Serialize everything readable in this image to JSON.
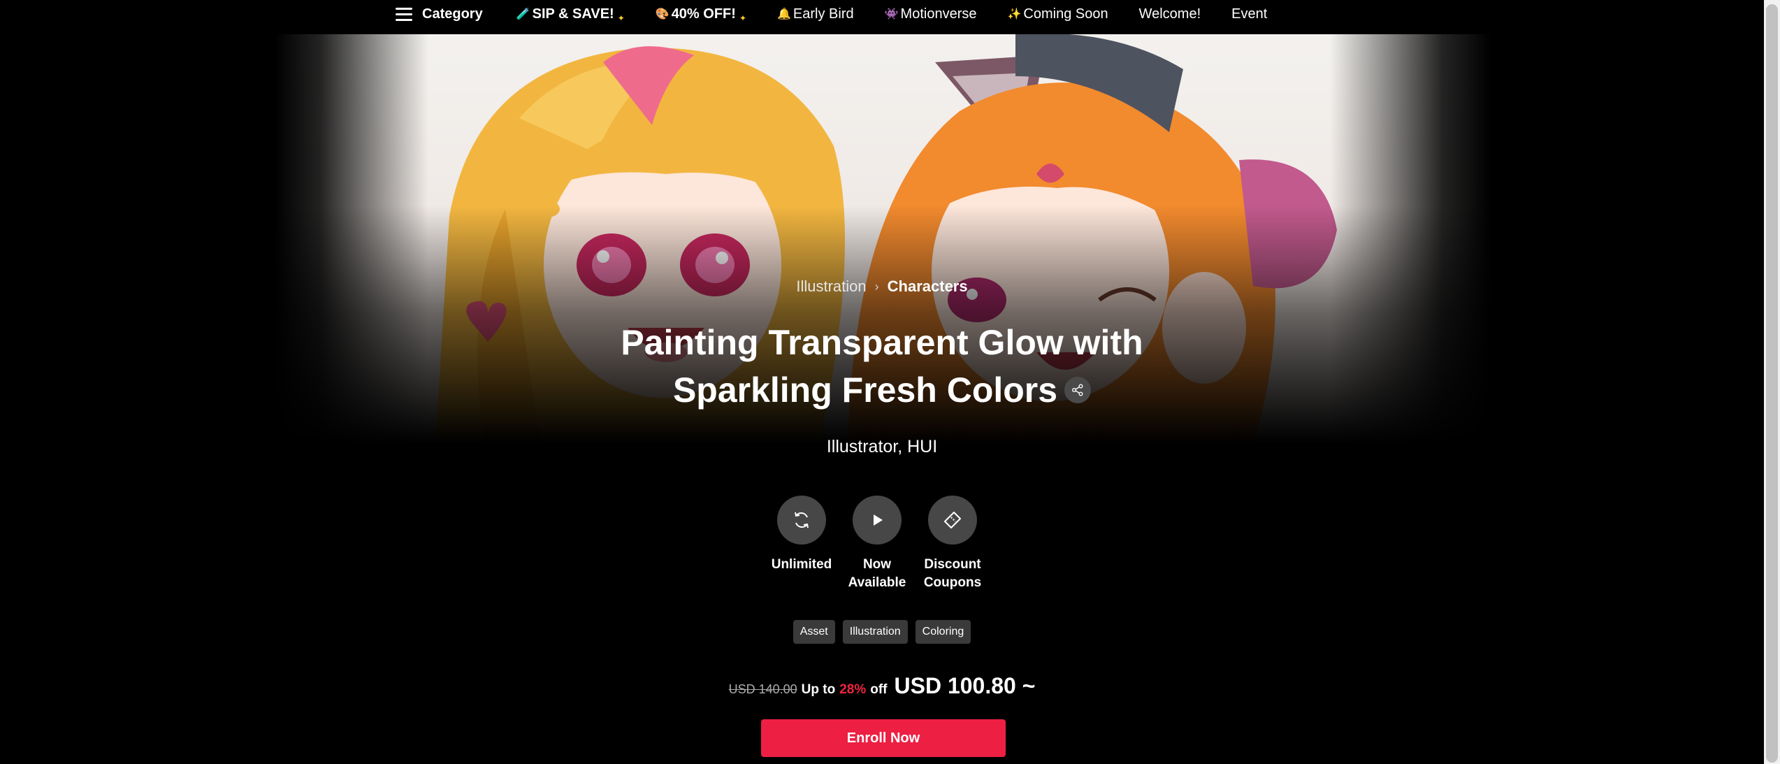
{
  "nav": {
    "category_label": "Category",
    "items": [
      {
        "emoji": "🧪",
        "label": "SIP & SAVE!",
        "spark": "✦",
        "bold": true
      },
      {
        "emoji": "🎨",
        "label": "40% OFF!",
        "spark": "✦",
        "bold": true
      },
      {
        "emoji": "🔔",
        "label": "Early Bird",
        "spark": "",
        "bold": false
      },
      {
        "emoji": "👾",
        "label": "Motionverse",
        "spark": "",
        "bold": false
      },
      {
        "emoji": "✨",
        "label": "Coming Soon",
        "spark": "",
        "bold": false
      },
      {
        "emoji": "",
        "label": "Welcome!",
        "spark": "",
        "bold": false
      },
      {
        "emoji": "",
        "label": "Event",
        "spark": "",
        "bold": false
      }
    ]
  },
  "breadcrumb": {
    "parent": "Illustration",
    "separator": "›",
    "current": "Characters"
  },
  "title": {
    "line1": "Painting Transparent Glow with",
    "line2": "Sparkling Fresh Colors"
  },
  "author": "Illustrator, HUI",
  "features": [
    {
      "icon": "refresh-icon",
      "label": "Unlimited"
    },
    {
      "icon": "play-icon",
      "label": "Now Available"
    },
    {
      "icon": "coupon-icon",
      "label": "Discount Coupons"
    }
  ],
  "tags": [
    "Asset",
    "Illustration",
    "Coloring"
  ],
  "price": {
    "original": "USD 140.00",
    "up_to": "Up to",
    "percent": "28%",
    "off": "off",
    "current": "USD 100.80 ~"
  },
  "cta": {
    "label": "Enroll Now",
    "color": "#ed1f43"
  },
  "colors": {
    "accent": "#ed1f43",
    "background": "#000000"
  }
}
